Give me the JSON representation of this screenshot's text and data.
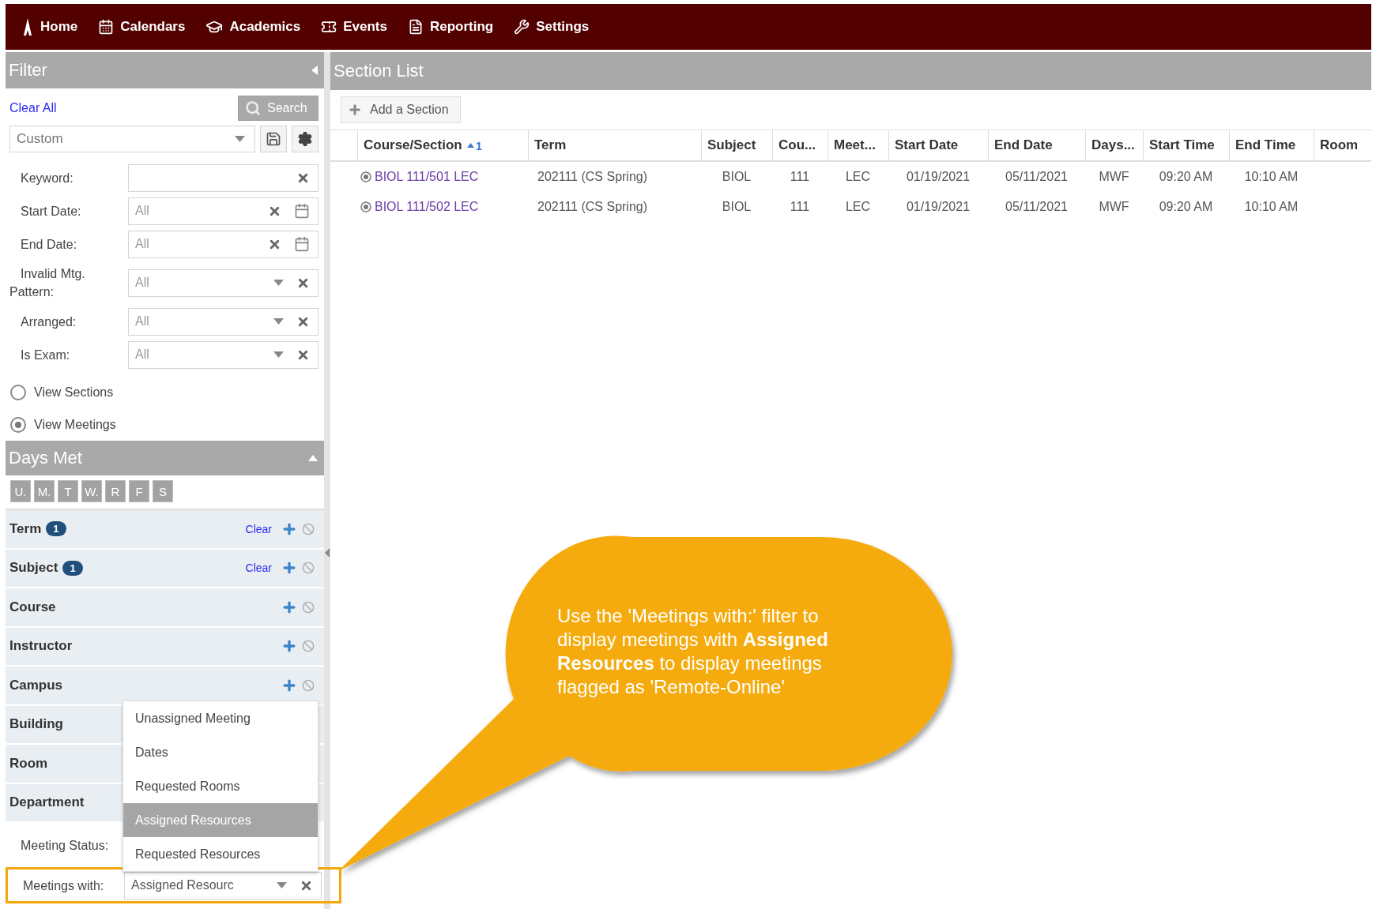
{
  "nav": {
    "items": [
      {
        "label": "Home"
      },
      {
        "label": "Calendars"
      },
      {
        "label": "Academics"
      },
      {
        "label": "Events"
      },
      {
        "label": "Reporting"
      },
      {
        "label": "Settings"
      }
    ]
  },
  "filter": {
    "title": "Filter",
    "clear_all": "Clear All",
    "search_button": "Search",
    "preset": {
      "value": "Custom"
    },
    "fields": [
      {
        "label": "Keyword:",
        "kind": "text"
      },
      {
        "label": "Start Date:",
        "kind": "date",
        "placeholder": "All"
      },
      {
        "label": "End Date:",
        "kind": "date",
        "placeholder": "All"
      },
      {
        "label": "Invalid Mtg. Pattern:",
        "kind": "select",
        "placeholder": "All"
      },
      {
        "label": "Arranged:",
        "kind": "select",
        "placeholder": "All"
      },
      {
        "label": "Is Exam:",
        "kind": "select",
        "placeholder": "All"
      }
    ],
    "view_options": [
      {
        "label": "View Sections",
        "selected": false
      },
      {
        "label": "View Meetings",
        "selected": true
      }
    ],
    "days_met": {
      "title": "Days Met",
      "days": [
        {
          "label": "U.",
          "selected": false
        },
        {
          "label": "M.",
          "selected": false
        },
        {
          "label": "T",
          "selected": false
        },
        {
          "label": "W.",
          "selected": false
        },
        {
          "label": "R",
          "selected": false
        },
        {
          "label": "F",
          "selected": false
        },
        {
          "label": "S",
          "selected": false
        }
      ]
    },
    "facets": [
      {
        "label": "Term",
        "count": "1",
        "clear": "Clear",
        "controls": true
      },
      {
        "label": "Subject",
        "count": "1",
        "clear": "Clear",
        "controls": true
      },
      {
        "label": "Course",
        "controls": true
      },
      {
        "label": "Instructor",
        "controls": true
      },
      {
        "label": "Campus",
        "controls": true
      },
      {
        "label": "Building"
      },
      {
        "label": "Room"
      },
      {
        "label": "Department"
      }
    ],
    "meeting_status": {
      "label": "Meeting Status:"
    },
    "meetings_with": {
      "label": "Meetings with:",
      "value": "Assigned Resourc"
    },
    "dropdown": {
      "options": [
        {
          "label": "Unassigned Meeting",
          "selected": false
        },
        {
          "label": "Dates",
          "selected": false
        },
        {
          "label": "Requested Rooms",
          "selected": false
        },
        {
          "label": "Assigned Resources",
          "selected": true
        },
        {
          "label": "Requested Resources",
          "selected": false
        }
      ]
    }
  },
  "section_list": {
    "title": "Section List",
    "add_button": "Add a Section",
    "table": {
      "columns": [
        {
          "label": "Course/Section",
          "sort": "1"
        },
        {
          "label": "Term"
        },
        {
          "label": "Subject"
        },
        {
          "label": "Cou..."
        },
        {
          "label": "Meet..."
        },
        {
          "label": "Start Date"
        },
        {
          "label": "End Date"
        },
        {
          "label": "Days..."
        },
        {
          "label": "Start Time"
        },
        {
          "label": "End Time"
        },
        {
          "label": "Room"
        }
      ],
      "rows": [
        {
          "cells": [
            "BIOL 111/501 LEC",
            "202111 (CS Spring)",
            "BIOL",
            "111",
            "LEC",
            "01/19/2021",
            "05/11/2021",
            "MWF",
            "09:20 AM",
            "10:10 AM"
          ]
        },
        {
          "cells": [
            "BIOL 111/502 LEC",
            "202111 (CS Spring)",
            "BIOL",
            "111",
            "LEC",
            "01/19/2021",
            "05/11/2021",
            "MWF",
            "09:20 AM",
            "10:10 AM"
          ]
        }
      ]
    }
  },
  "callout": {
    "text": "Use the 'Meetings with:' filter to display meetings with **Assigned Resources** to display meetings flagged as 'Remote-Online'"
  }
}
